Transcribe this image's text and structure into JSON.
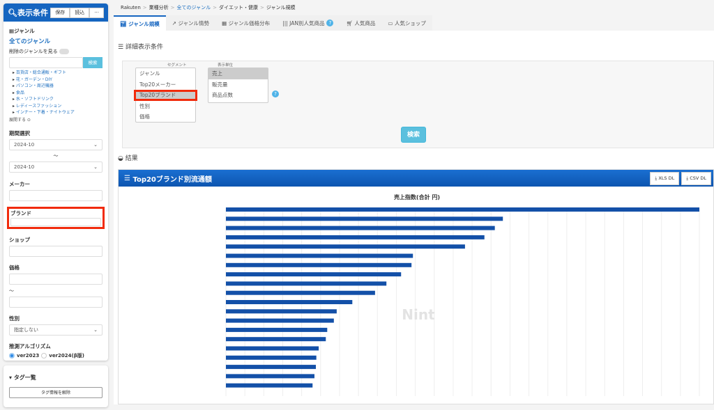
{
  "sidebar": {
    "title": "表示条件",
    "save": "保存",
    "load": "読込",
    "more": "···",
    "genre_label": "ジャンル",
    "all_genres": "全てのジャンル",
    "show_deleted": "削除のジャンルを見る",
    "search_button": "検索",
    "genres": [
      "百貨店・総合通販・ギフト",
      "花・ガーデン・DIY",
      "パソコン・周辺機器",
      "食品",
      "水・ソフトドリンク",
      "レディースファッション",
      "インナー・下着・ナイトウェア"
    ],
    "expand": "展開する",
    "period_label": "期間選択",
    "period_from": "2024-10",
    "tilde": "〜",
    "period_to": "2024-10",
    "maker_label": "メーカー",
    "brand_label": "ブランド",
    "shop_label": "ショップ",
    "price_label": "価格",
    "price_tilde": "〜",
    "gender_label": "性別",
    "gender_value": "指定しない",
    "algo_label": "推測アルゴリズム",
    "algo_options": [
      "ver2023",
      "ver2024(β版)"
    ],
    "tag_title": "タグ一覧",
    "tag_clear": "タグ情報を解除"
  },
  "breadcrumb": [
    "Rakuten",
    "業種分析",
    "全てのジャンル",
    "ダイエット・健康",
    "ジャンル規模"
  ],
  "tabs": [
    "ジャンル規模",
    "ジャンル情勢",
    "ジャンル価格分布",
    "JAN別人気商品",
    "人気商品",
    "人気ショップ"
  ],
  "conditions": {
    "title": "詳細表示条件",
    "segment_caption": "セグメント",
    "segments": [
      "ジャンル",
      "Top20メーカー",
      "Top20ブランド",
      "性別",
      "価格"
    ],
    "unit_caption": "表示単位",
    "units": [
      "売上",
      "販売量",
      "商品点数"
    ],
    "search": "検索"
  },
  "results": {
    "title": "結果",
    "panel_title": "Top20ブランド別流通額",
    "xls": "XLS DL",
    "csv": "CSV DL"
  },
  "chart_data": {
    "type": "bar",
    "orientation": "horizontal",
    "title": "売上指数(合計                円)",
    "values": [
      100,
      58.5,
      56.8,
      54.6,
      50.5,
      39.5,
      39.2,
      37.0,
      33.9,
      31.5,
      26.7,
      23.4,
      22.8,
      21.4,
      21.1,
      19.6,
      19.1,
      19.0,
      18.7,
      18.3
    ],
    "xlim": [
      0,
      100
    ],
    "grid": true,
    "color": "#1350a8"
  }
}
